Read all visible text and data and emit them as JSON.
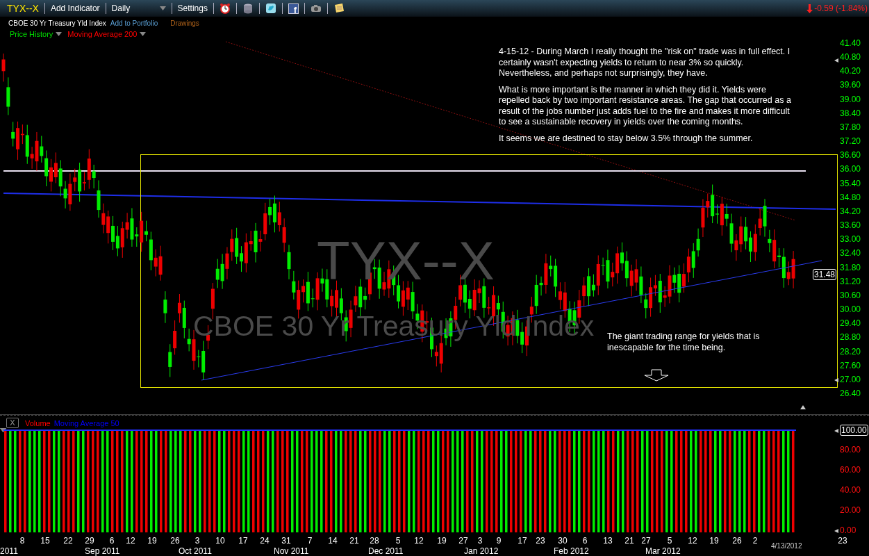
{
  "toolbar": {
    "symbol": "TYX--X",
    "add_indicator": "Add Indicator",
    "period": "Daily",
    "settings": "Settings",
    "facebook_glyph": "f",
    "change": "-0.59 (-1.84%)"
  },
  "header": {
    "name": "CBOE 30 Yr Treasury Yld Index",
    "add_to_portfolio": "Add to Portfolio",
    "drawings": "Drawings"
  },
  "price_panel": {
    "legend": [
      {
        "label": "Price History",
        "color": "#00e000"
      },
      {
        "label": "Moving Average 200",
        "color": "#ff0000"
      }
    ],
    "watermark_symbol": "TYX--X",
    "watermark_name": "CBOE 30 Yr Treasury Yld Index",
    "note": [
      "4-15-12 - During March I really thought the \"risk on\" trade was in full effect. I certainly wasn't expecting yields to return to near 3% so quickly. Nevertheless, and perhaps not surprisingly, they have.",
      "What is more important is the manner in which they did it. Yields were repelled back by two important resistance areas. The gap that occurred as a result of the jobs number just adds fuel to the fire and makes it more difficult to see a sustainable recovery in yields over the coming months.",
      "It seems we are destined to stay below 3.5% through the summer."
    ],
    "range_note": "The giant trading range for yields that is inescapable for the time being.",
    "axis_labels": [
      "41.40",
      "40.80",
      "40.20",
      "39.60",
      "39.00",
      "38.40",
      "37.80",
      "37.20",
      "36.60",
      "36.00",
      "35.40",
      "34.80",
      "34.20",
      "33.60",
      "33.00",
      "32.40",
      "31.80",
      "31.20",
      "30.60",
      "30.00",
      "29.40",
      "28.80",
      "28.20",
      "27.60",
      "27.00",
      "26.40"
    ],
    "last_price": "31.48"
  },
  "volume_panel": {
    "close": "X",
    "legend": [
      {
        "label": "Volume",
        "color": "#ff0000"
      },
      {
        "label": "Moving Average 50",
        "color": "#0000ff"
      }
    ],
    "current_value": "100.00",
    "axis_labels": [
      "80.00",
      "60.00",
      "40.00",
      "20.00",
      "0.00"
    ]
  },
  "date_axis": {
    "days": [
      "8",
      "15",
      "22",
      "29",
      "6",
      "12",
      "19",
      "26",
      "3",
      "10",
      "17",
      "24",
      "31",
      "7",
      "14",
      "21",
      "28",
      "5",
      "12",
      "19",
      "27",
      "3",
      "9",
      "17",
      "23",
      "30",
      "6",
      "13",
      "21",
      "27",
      "5",
      "12",
      "19",
      "26",
      "2",
      "23"
    ],
    "months": [
      "2011",
      "Sep 2011",
      "Oct 2011",
      "Nov 2011",
      "Dec 2011",
      "Jan 2012",
      "Feb 2012",
      "Mar 2012"
    ],
    "last_date": "4/13/2012"
  }
}
